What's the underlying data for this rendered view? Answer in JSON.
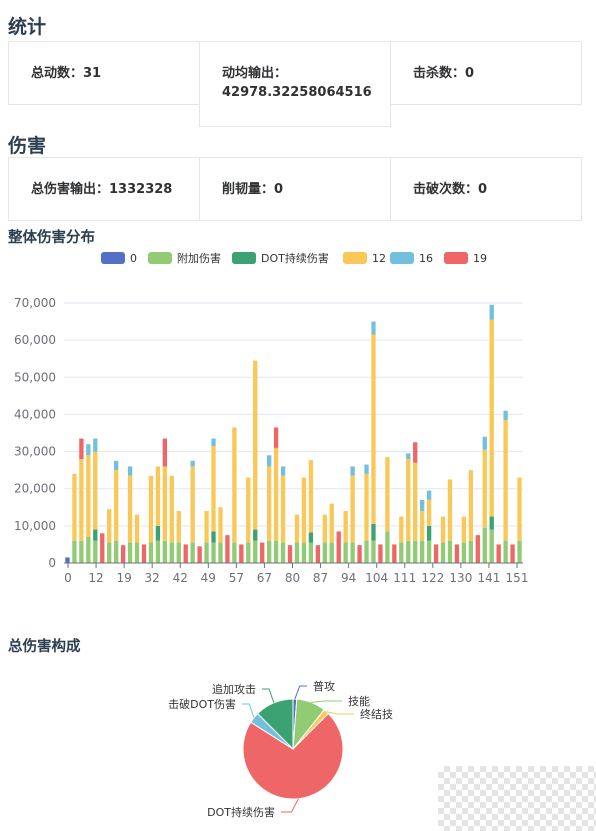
{
  "sections": {
    "stats_title": "统计",
    "damage_title": "伤害"
  },
  "stats": [
    {
      "label": "总动数：",
      "value": "31"
    },
    {
      "label": "动均输出：",
      "value": "42978.32258064516"
    },
    {
      "label": "击杀数：",
      "value": "0"
    }
  ],
  "damage": [
    {
      "label": "总伤害输出：",
      "value": "1332328"
    },
    {
      "label": "削韧量：",
      "value": "0"
    },
    {
      "label": "击破次数：",
      "value": "0"
    }
  ],
  "colors": {
    "s0": "#5470c6",
    "s_extra": "#91cc75",
    "s_dot": "#3ba272",
    "s12": "#fac858",
    "s16": "#73c0de",
    "s19": "#ee6666"
  },
  "chart_data": [
    {
      "type": "bar",
      "stacked": true,
      "title": "整体伤害分布",
      "legend_position": "top-center",
      "legend": [
        "0",
        "附加伤害",
        "DOT持续伤害",
        "12",
        "16",
        "19"
      ],
      "x_tick_labels": [
        "0",
        "12",
        "19",
        "32",
        "42",
        "49",
        "57",
        "67",
        "80",
        "87",
        "94",
        "104",
        "111",
        "122",
        "130",
        "141",
        "151"
      ],
      "y_ticks": [
        "0",
        "10,000",
        "20,000",
        "30,000",
        "40,000",
        "50,000",
        "60,000",
        "70,000"
      ],
      "ylim": [
        0,
        70000
      ],
      "grid": true,
      "bars": [
        {
          "s0": 1500
        },
        {
          "s_extra": 6000,
          "s12": 18000
        },
        {
          "s_extra": 6000,
          "s12": 22000,
          "s19": 5500
        },
        {
          "s_extra": 7000,
          "s12": 22000,
          "s16": 3000
        },
        {
          "s_extra": 6000,
          "s12": 21000,
          "s16": 3500,
          "s_dot": 3000
        },
        {
          "s19": 8000
        },
        {
          "s_extra": 5500,
          "s12": 9000
        },
        {
          "s_extra": 6000,
          "s12": 19000,
          "s16": 2500
        },
        {
          "s19": 4800
        },
        {
          "s_extra": 5500,
          "s12": 18000,
          "s16": 2500
        },
        {
          "s_extra": 5500,
          "s12": 7500
        },
        {
          "s19": 5000
        },
        {
          "s_extra": 5500,
          "s12": 18000
        },
        {
          "s_extra": 6000,
          "s12": 16000,
          "s_dot": 4000
        },
        {
          "s_extra": 6000,
          "s12": 20000,
          "s19": 7500
        },
        {
          "s_extra": 5500,
          "s12": 18000
        },
        {
          "s_extra": 5500,
          "s12": 8500
        },
        {
          "s19": 5000
        },
        {
          "s_extra": 5500,
          "s12": 20500,
          "s16": 1500
        },
        {
          "s19": 4500
        },
        {
          "s_extra": 5500,
          "s12": 8500
        },
        {
          "s_extra": 5500,
          "s12": 23000,
          "s16": 2000,
          "s_dot": 3000
        },
        {
          "s_extra": 5500,
          "s12": 9500
        },
        {
          "s19": 7500
        },
        {
          "s_extra": 5500,
          "s12": 31000
        },
        {
          "s19": 5000
        },
        {
          "s_extra": 5500,
          "s12": 17500
        },
        {
          "s_extra": 6000,
          "s12": 45500,
          "s_dot": 3000
        },
        {
          "s19": 5500
        },
        {
          "s_extra": 6000,
          "s12": 20000,
          "s16": 3000
        },
        {
          "s_extra": 6000,
          "s12": 25000,
          "s19": 5500
        },
        {
          "s_extra": 5500,
          "s12": 18000,
          "s16": 2500
        },
        {
          "s19": 4800
        },
        {
          "s_extra": 5500,
          "s12": 7500
        },
        {
          "s_extra": 5500,
          "s12": 17500
        },
        {
          "s_extra": 5500,
          "s12": 19500,
          "s_dot": 2700
        },
        {
          "s19": 4800
        },
        {
          "s_extra": 5500,
          "s12": 7500
        },
        {
          "s_extra": 5500,
          "s12": 10500
        },
        {
          "s19": 8500
        },
        {
          "s_extra": 5500,
          "s12": 8500
        },
        {
          "s_extra": 5500,
          "s12": 18000,
          "s16": 2500
        },
        {
          "s19": 4800
        },
        {
          "s_extra": 6000,
          "s12": 18000,
          "s16": 2500
        },
        {
          "s_extra": 6000,
          "s12": 51000,
          "s16": 3500,
          "s_dot": 4500
        },
        {
          "s19": 5000
        },
        {
          "s_extra": 8500,
          "s12": 20000
        },
        {
          "s19": 5000
        },
        {
          "s_extra": 5500,
          "s12": 7000
        },
        {
          "s_extra": 6000,
          "s12": 22000,
          "s16": 1500
        },
        {
          "s_extra": 6000,
          "s12": 21000,
          "s19": 5500
        },
        {
          "s_extra": 6000,
          "s12": 8000,
          "s16": 3000
        },
        {
          "s_extra": 6000,
          "s12": 7000,
          "s16": 2500,
          "s_dot": 4000
        },
        {
          "s19": 5000
        },
        {
          "s_extra": 5500,
          "s12": 7000
        },
        {
          "s_extra": 6000,
          "s12": 16500
        },
        {
          "s19": 5000
        },
        {
          "s_extra": 5500,
          "s12": 7000
        },
        {
          "s_extra": 6000,
          "s12": 19000
        },
        {
          "s19": 7500
        },
        {
          "s_extra": 9500,
          "s12": 21000,
          "s16": 3500
        },
        {
          "s_extra": 9000,
          "s12": 53000,
          "s16": 4000,
          "s_dot": 3500
        },
        {
          "s19": 5000
        },
        {
          "s_extra": 6000,
          "s12": 32500,
          "s16": 2500
        },
        {
          "s19": 5000
        },
        {
          "s_extra": 6000,
          "s12": 17000
        }
      ]
    },
    {
      "type": "pie",
      "title": "总伤害构成",
      "slices": [
        {
          "label": "普攻",
          "value": 1.2,
          "color": "#5470c6"
        },
        {
          "label": "技能",
          "value": 9.5,
          "color": "#91cc75"
        },
        {
          "label": "终结技",
          "value": 1.8,
          "color": "#fac858"
        },
        {
          "label": "DOT持续伤害",
          "value": 71.5,
          "color": "#ee6666"
        },
        {
          "label": "击破DOT伤害",
          "value": 3.5,
          "color": "#73c0de"
        },
        {
          "label": "追加攻击",
          "value": 12.5,
          "color": "#3ba272"
        }
      ]
    }
  ]
}
